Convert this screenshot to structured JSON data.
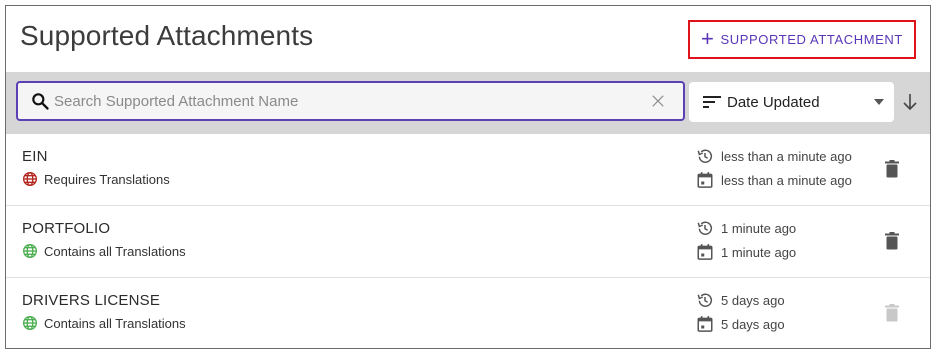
{
  "header": {
    "title": "Supported Attachments",
    "add_button_label": "SUPPORTED ATTACHMENT",
    "add_button_icon": "plus-icon"
  },
  "toolbar": {
    "search": {
      "placeholder": "Search Supported Attachment Name",
      "value": ""
    },
    "sort": {
      "selected": "Date Updated",
      "direction": "descending"
    }
  },
  "colors": {
    "accent": "#5a36b8",
    "highlight_border": "#e0131b",
    "requires_translations": "#b3261e",
    "contains_all_translations": "#4caf50",
    "toolbar_bg": "#d6d6d6"
  },
  "items": [
    {
      "name": "EIN",
      "status": "Requires Translations",
      "status_kind": "requires",
      "updated": "less than a minute ago",
      "created": "less than a minute ago",
      "delete_enabled": true
    },
    {
      "name": "PORTFOLIO",
      "status": "Contains all Translations",
      "status_kind": "complete",
      "updated": "1 minute ago",
      "created": "1 minute ago",
      "delete_enabled": true
    },
    {
      "name": "DRIVERS LICENSE",
      "status": "Contains all Translations",
      "status_kind": "complete",
      "updated": "5 days ago",
      "created": "5 days ago",
      "delete_enabled": false
    }
  ]
}
